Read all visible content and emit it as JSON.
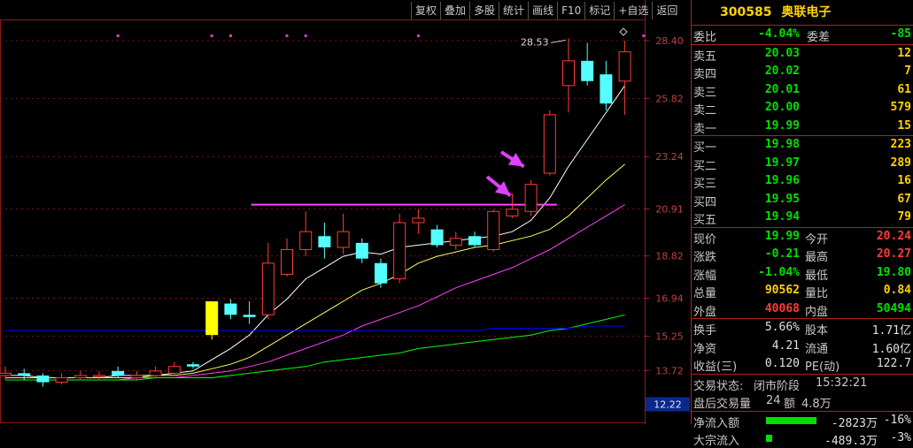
{
  "toolbar": [
    "复权",
    "叠加",
    "多股",
    "统计",
    "画线",
    "F10",
    "标记",
    "+自选",
    "返回"
  ],
  "stock": {
    "code": "300585",
    "name": "奥联电子"
  },
  "weibi": {
    "label": "委比",
    "value": "-4.04%",
    "diff_label": "委差",
    "diff": "-85"
  },
  "asks": [
    {
      "label": "卖五",
      "price": "20.03",
      "vol": "12"
    },
    {
      "label": "卖四",
      "price": "20.02",
      "vol": "7"
    },
    {
      "label": "卖三",
      "price": "20.01",
      "vol": "61"
    },
    {
      "label": "卖二",
      "price": "20.00",
      "vol": "579"
    },
    {
      "label": "卖一",
      "price": "19.99",
      "vol": "15"
    }
  ],
  "bids": [
    {
      "label": "买一",
      "price": "19.98",
      "vol": "223"
    },
    {
      "label": "买二",
      "price": "19.97",
      "vol": "289"
    },
    {
      "label": "买三",
      "price": "19.96",
      "vol": "16"
    },
    {
      "label": "买四",
      "price": "19.95",
      "vol": "67"
    },
    {
      "label": "买五",
      "price": "19.94",
      "vol": "79"
    }
  ],
  "quote": [
    {
      "l1": "现价",
      "v1": "19.99",
      "c1": "green",
      "l2": "今开",
      "v2": "20.24",
      "c2": "red"
    },
    {
      "l1": "涨跌",
      "v1": "-0.21",
      "c1": "green",
      "l2": "最高",
      "v2": "20.27",
      "c2": "red"
    },
    {
      "l1": "涨幅",
      "v1": "-1.04%",
      "c1": "green",
      "l2": "最低",
      "v2": "19.80",
      "c2": "green"
    },
    {
      "l1": "总量",
      "v1": "90562",
      "c1": "yellow",
      "l2": "量比",
      "v2": "0.84",
      "c2": "yellow"
    },
    {
      "l1": "外盘",
      "v1": "40068",
      "c1": "red",
      "l2": "内盘",
      "v2": "50494",
      "c2": "green"
    }
  ],
  "fundamentals": [
    {
      "l1": "换手",
      "v1": "5.66%",
      "l2": "股本",
      "v2": "1.71亿"
    },
    {
      "l1": "净资",
      "v1": "4.21",
      "l2": "流通",
      "v2": "1.60亿"
    },
    {
      "l1": "收益(三)",
      "v1": "0.120",
      "l2": "PE(动)",
      "v2": "122.7"
    }
  ],
  "status": {
    "state_label": "交易状态:",
    "state": "闭市阶段",
    "time": "15:32:21",
    "after_label": "盘后交易量",
    "after_vol": "24",
    "amt_label": "额",
    "amt": "4.8万"
  },
  "flows": [
    {
      "label": "净流入额",
      "value": "-2823万",
      "pct": "-16%",
      "fill": 0.95
    },
    {
      "label": "大宗流入",
      "value": "-489.3万",
      "pct": "-3%",
      "fill": 0.12
    }
  ],
  "colors": {
    "up": "#ff3b3b",
    "down": "#54ffff",
    "limit": "#ffff00",
    "ma1": "#ffffff",
    "ma2": "#ffff60",
    "ma3": "#ff40ff",
    "ma4": "#00ff00",
    "ma5": "#0000ff",
    "hline": "#ff40ff",
    "arrow": "#e040ff"
  },
  "chart_data": {
    "type": "candlestick",
    "y_ticks": [
      "28.40",
      "25.82",
      "23.24",
      "20.91",
      "18.82",
      "16.94",
      "15.25",
      "13.72"
    ],
    "price_marker": "12.22",
    "high_label": "28.53",
    "ylim": [
      12.2,
      29.5
    ],
    "candles": [
      {
        "o": 13.5,
        "c": 13.6,
        "h": 13.9,
        "l": 13.3,
        "k": "up"
      },
      {
        "o": 13.6,
        "c": 13.5,
        "h": 13.8,
        "l": 13.3,
        "k": "down"
      },
      {
        "o": 13.5,
        "c": 13.2,
        "h": 13.6,
        "l": 13.0,
        "k": "down"
      },
      {
        "o": 13.2,
        "c": 13.4,
        "h": 13.6,
        "l": 13.1,
        "k": "up"
      },
      {
        "o": 13.4,
        "c": 13.5,
        "h": 13.7,
        "l": 13.3,
        "k": "up"
      },
      {
        "o": 13.5,
        "c": 13.5,
        "h": 13.7,
        "l": 13.3,
        "k": "up"
      },
      {
        "o": 13.7,
        "c": 13.5,
        "h": 13.9,
        "l": 13.4,
        "k": "down"
      },
      {
        "o": 13.4,
        "c": 13.5,
        "h": 13.7,
        "l": 13.3,
        "k": "up"
      },
      {
        "o": 13.5,
        "c": 13.7,
        "h": 13.9,
        "l": 13.4,
        "k": "up"
      },
      {
        "o": 13.6,
        "c": 13.9,
        "h": 14.1,
        "l": 13.5,
        "k": "up"
      },
      {
        "o": 14.0,
        "c": 13.9,
        "h": 14.1,
        "l": 13.8,
        "k": "down"
      },
      {
        "o": 15.3,
        "c": 16.8,
        "h": 16.8,
        "l": 15.1,
        "k": "limit"
      },
      {
        "o": 16.7,
        "c": 16.2,
        "h": 16.9,
        "l": 16.0,
        "k": "down"
      },
      {
        "o": 16.2,
        "c": 16.1,
        "h": 16.8,
        "l": 15.8,
        "k": "down"
      },
      {
        "o": 16.2,
        "c": 18.5,
        "h": 19.4,
        "l": 16.0,
        "k": "up"
      },
      {
        "o": 18.0,
        "c": 19.1,
        "h": 19.6,
        "l": 17.9,
        "k": "up"
      },
      {
        "o": 19.1,
        "c": 19.9,
        "h": 20.8,
        "l": 18.8,
        "k": "up"
      },
      {
        "o": 19.7,
        "c": 19.2,
        "h": 20.3,
        "l": 18.7,
        "k": "down"
      },
      {
        "o": 19.2,
        "c": 19.9,
        "h": 20.7,
        "l": 18.9,
        "k": "up"
      },
      {
        "o": 19.4,
        "c": 18.7,
        "h": 19.6,
        "l": 18.5,
        "k": "down"
      },
      {
        "o": 18.5,
        "c": 17.6,
        "h": 18.7,
        "l": 17.4,
        "k": "down"
      },
      {
        "o": 17.8,
        "c": 20.3,
        "h": 20.7,
        "l": 17.6,
        "k": "up"
      },
      {
        "o": 20.5,
        "c": 20.3,
        "h": 20.9,
        "l": 19.8,
        "k": "up"
      },
      {
        "o": 20.0,
        "c": 19.3,
        "h": 20.2,
        "l": 19.2,
        "k": "down"
      },
      {
        "o": 19.3,
        "c": 19.6,
        "h": 19.9,
        "l": 19.1,
        "k": "up"
      },
      {
        "o": 19.7,
        "c": 19.3,
        "h": 19.9,
        "l": 19.2,
        "k": "down"
      },
      {
        "o": 19.1,
        "c": 20.8,
        "h": 20.9,
        "l": 19.0,
        "k": "up"
      },
      {
        "o": 20.6,
        "c": 20.9,
        "h": 21.6,
        "l": 20.5,
        "k": "up"
      },
      {
        "o": 20.8,
        "c": 22.0,
        "h": 22.2,
        "l": 20.6,
        "k": "up"
      },
      {
        "o": 22.5,
        "c": 25.1,
        "h": 25.3,
        "l": 22.4,
        "k": "up"
      },
      {
        "o": 26.4,
        "c": 27.5,
        "h": 28.5,
        "l": 25.2,
        "k": "up"
      },
      {
        "o": 27.5,
        "c": 26.6,
        "h": 28.3,
        "l": 26.4,
        "k": "down"
      },
      {
        "o": 26.9,
        "c": 25.6,
        "h": 27.5,
        "l": 25.3,
        "k": "down"
      },
      {
        "o": 26.6,
        "c": 27.9,
        "h": 28.4,
        "l": 25.1,
        "k": "up"
      }
    ],
    "ma_series": [
      {
        "color": "ma1",
        "values": [
          13.5,
          13.5,
          13.4,
          13.4,
          13.4,
          13.4,
          13.5,
          13.5,
          13.5,
          13.6,
          13.7,
          14.2,
          14.7,
          15.3,
          16.2,
          16.9,
          17.8,
          18.3,
          18.8,
          19.0,
          18.9,
          19.2,
          19.3,
          19.4,
          19.5,
          19.6,
          19.7,
          19.9,
          20.4,
          21.4,
          22.8,
          24.0,
          25.2,
          26.4
        ]
      },
      {
        "color": "ma2",
        "values": [
          13.4,
          13.4,
          13.4,
          13.4,
          13.4,
          13.4,
          13.4,
          13.4,
          13.5,
          13.5,
          13.6,
          13.8,
          14.0,
          14.3,
          14.8,
          15.3,
          15.8,
          16.3,
          16.8,
          17.3,
          17.6,
          18.0,
          18.5,
          18.8,
          19.0,
          19.2,
          19.3,
          19.5,
          19.7,
          20.0,
          20.6,
          21.4,
          22.2,
          22.9
        ]
      },
      {
        "color": "ma3",
        "values": [
          13.3,
          13.3,
          13.3,
          13.3,
          13.3,
          13.3,
          13.3,
          13.4,
          13.4,
          13.4,
          13.5,
          13.6,
          13.7,
          13.9,
          14.1,
          14.4,
          14.7,
          15.0,
          15.3,
          15.7,
          16.0,
          16.3,
          16.6,
          17.0,
          17.4,
          17.7,
          18.0,
          18.3,
          18.7,
          19.1,
          19.6,
          20.1,
          20.6,
          21.1
        ]
      },
      {
        "color": "ma4",
        "values": [
          13.3,
          13.3,
          13.3,
          13.3,
          13.3,
          13.3,
          13.3,
          13.3,
          13.4,
          13.4,
          13.4,
          13.4,
          13.5,
          13.6,
          13.7,
          13.8,
          13.9,
          14.1,
          14.2,
          14.3,
          14.4,
          14.5,
          14.7,
          14.8,
          14.9,
          15.0,
          15.1,
          15.2,
          15.3,
          15.5,
          15.6,
          15.8,
          16.0,
          16.2
        ]
      },
      {
        "color": "ma5",
        "values": [
          15.5,
          15.5,
          15.5,
          15.5,
          15.5,
          15.5,
          15.5,
          15.5,
          15.5,
          15.5,
          15.5,
          15.5,
          15.5,
          15.5,
          15.5,
          15.5,
          15.5,
          15.5,
          15.5,
          15.5,
          15.5,
          15.5,
          15.5,
          15.5,
          15.5,
          15.5,
          15.6,
          15.6,
          15.6,
          15.6,
          15.6,
          15.7,
          15.7,
          15.7
        ]
      }
    ],
    "hline": {
      "value": 21.1,
      "from": 13,
      "to": 29
    }
  }
}
